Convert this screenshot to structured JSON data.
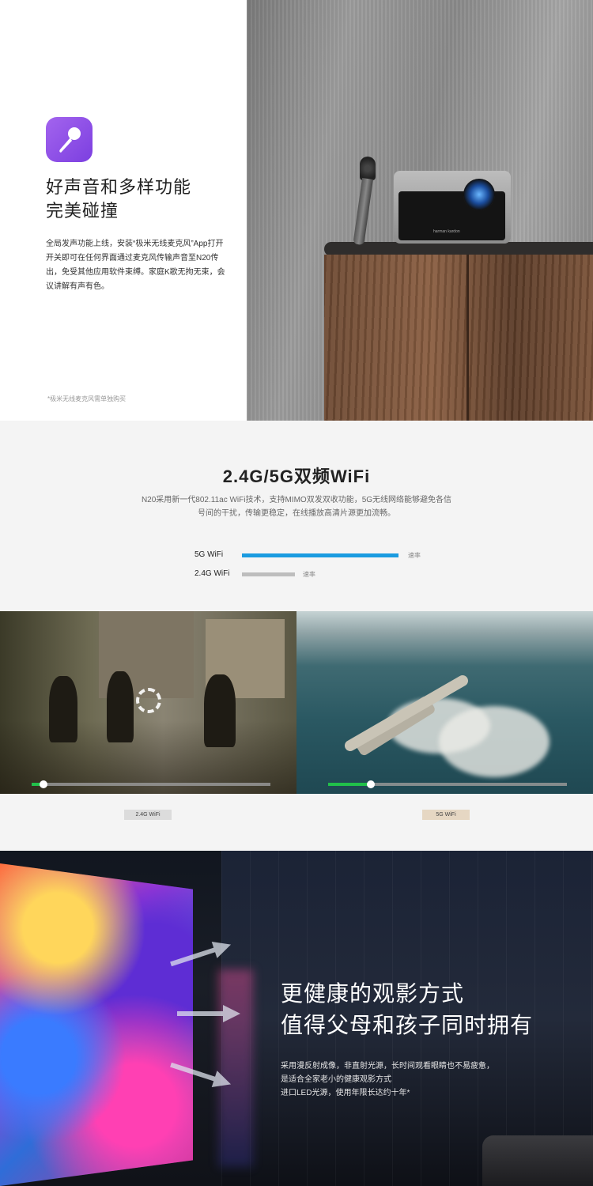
{
  "karaoke": {
    "icon": "microphone-icon",
    "icon_color": "#7c3fe0",
    "title_line1": "好声音和多样功能",
    "title_line2": "完美碰撞",
    "description": "全局发声功能上线，安装“极米无线麦克风”App打开开关即可在任何界面通过麦克风传输声音至N20传出，免受其他应用软件束缚。家庭K歌无拘无束，会议讲解有声有色。",
    "note": "*极米无线麦克风需单独购买",
    "projector_brand": "harman kardon"
  },
  "wifi": {
    "title": "2.4G/5G双频WiFi",
    "description": "N20采用新一代802.11ac WiFi技术，支持MIMO双发双收功能，5G无线网络能够避免各信号间的干扰，传输更稳定，在线播放高清片源更加流畅。",
    "bars": [
      {
        "label": "5G WiFi",
        "suffix": "速率",
        "relative_speed": 1.0,
        "color": "#1a9be0"
      },
      {
        "label": "2.4G WiFi",
        "suffix": "速率",
        "relative_speed": 0.34,
        "color": "#bdbdbd"
      }
    ],
    "videos": [
      {
        "tag": "2.4G WiFi",
        "tag_color": "#dcdcdc",
        "progress": 0.05,
        "loading": true
      },
      {
        "tag": "5G WiFi",
        "tag_color": "#e6d7c3",
        "progress": 0.18,
        "loading": false
      }
    ],
    "progress_color": "#21c04a"
  },
  "health": {
    "title_line1": "更健康的观影方式",
    "title_line2": "值得父母和孩子同时拥有",
    "description_line1": "采用漫反射成像，非直射光源，长时间观看眼睛也不易疲惫，",
    "description_line2": "是适合全家老小的健康观影方式",
    "description_line3": "进口LED光源，使用年限长达约十年*",
    "arrow_icon": "arrow-right-icon"
  }
}
